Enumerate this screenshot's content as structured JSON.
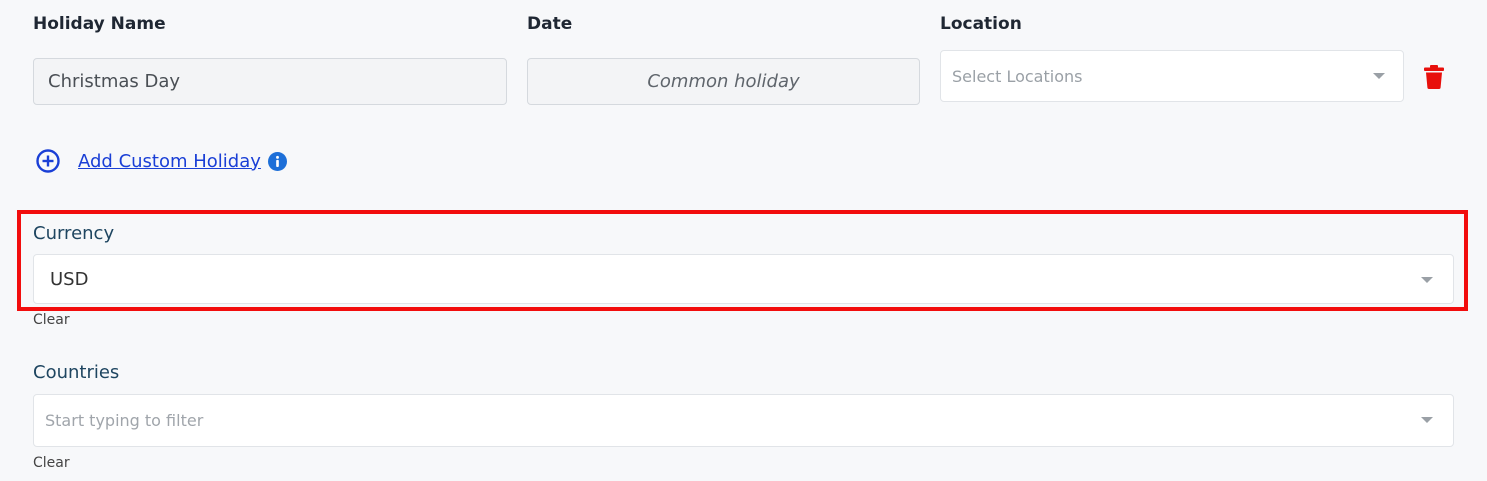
{
  "holiday": {
    "name_header": "Holiday Name",
    "date_header": "Date",
    "location_header": "Location",
    "name_value": "Christmas Day",
    "date_value": "Common holiday",
    "location_placeholder": "Select Locations"
  },
  "add_custom_holiday": {
    "label": "Add Custom Holiday"
  },
  "currency": {
    "label": "Currency",
    "value": "USD",
    "clear_label": "Clear"
  },
  "countries": {
    "label": "Countries",
    "placeholder": "Start typing to filter",
    "clear_label": "Clear"
  },
  "colors": {
    "highlight": "#f20d0d",
    "link": "#1a3fd6",
    "delete": "#e8100c",
    "info": "#1d6fd8",
    "section_label": "#1e4560"
  },
  "icons": {
    "delete": "trash-icon",
    "add": "plus-circle-icon",
    "info": "info-icon",
    "dropdown": "chevron-down-icon"
  }
}
